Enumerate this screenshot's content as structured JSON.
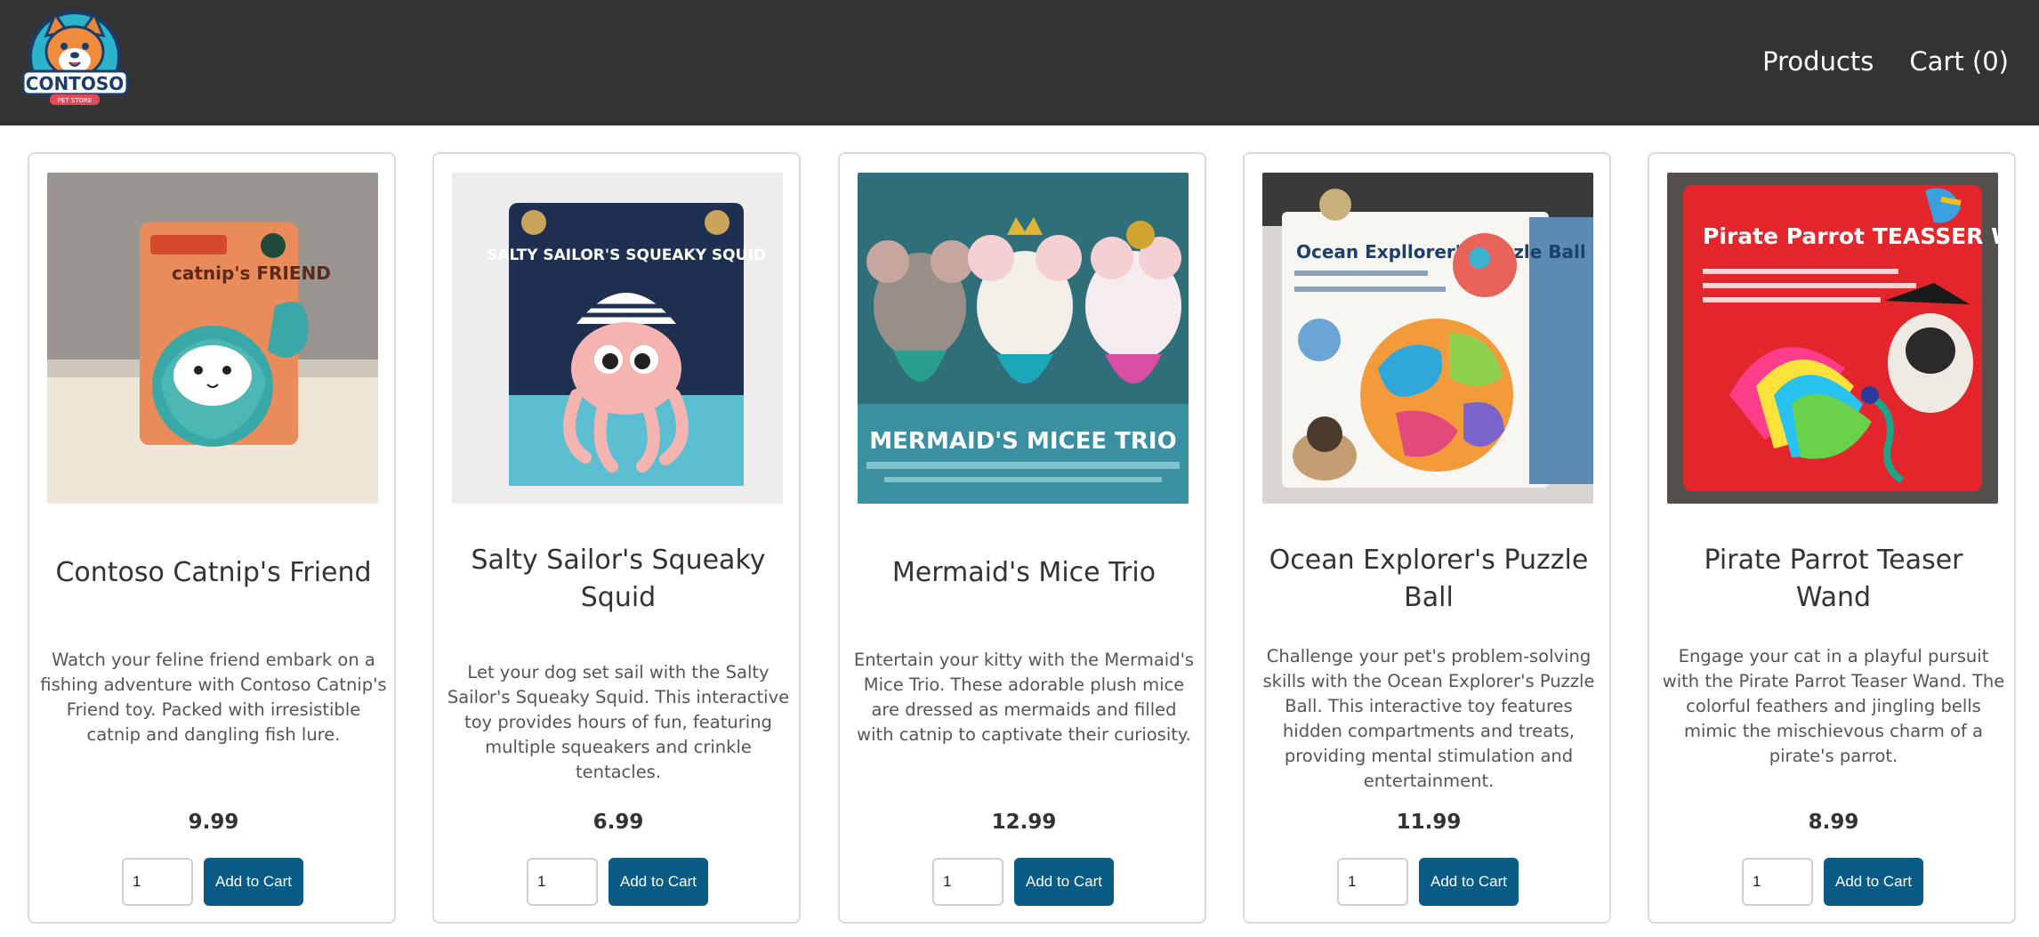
{
  "header": {
    "logo_alt": "Contoso Pet Store logo",
    "logo_text": "CONTOSO",
    "logo_subtext": "PET STORE",
    "nav": [
      {
        "label": "Products"
      },
      {
        "label": "Cart (0)"
      }
    ]
  },
  "colors": {
    "navbar_bg": "#333333",
    "button_bg": "#0a5b86",
    "card_border": "#dadada"
  },
  "products": [
    {
      "name": "Contoso Catnip's Friend",
      "description": "Watch your feline friend embark on a fishing adventure with Contoso Catnip's Friend toy. Packed with irresistible catnip and dangling fish lure.",
      "price": "9.99",
      "quantity": "1",
      "button_label": "Add to Cart",
      "image_text": "catnip's FRIEND"
    },
    {
      "name": "Salty Sailor's Squeaky Squid",
      "description": "Let your dog set sail with the Salty Sailor's Squeaky Squid. This interactive toy provides hours of fun, featuring multiple squeakers and crinkle tentacles.",
      "price": "6.99",
      "quantity": "1",
      "button_label": "Add to Cart",
      "image_text": "SALTY SAILOR'S SQUEAKY SQUID"
    },
    {
      "name": "Mermaid's Mice Trio",
      "description": "Entertain your kitty with the Mermaid's Mice Trio. These adorable plush mice are dressed as mermaids and filled with catnip to captivate their curiosity.",
      "price": "12.99",
      "quantity": "1",
      "button_label": "Add to Cart",
      "image_text": "MERMAID'S MICEE TRIO"
    },
    {
      "name": "Ocean Explorer's Puzzle Ball",
      "description": "Challenge your pet's problem-solving skills with the Ocean Explorer's Puzzle Ball. This interactive toy features hidden compartments and treats, providing mental stimulation and entertainment.",
      "price": "11.99",
      "quantity": "1",
      "button_label": "Add to Cart",
      "image_text": "Ocean Expllorer's Puzzle Ball"
    },
    {
      "name": "Pirate Parrot Teaser Wand",
      "description": "Engage your cat in a playful pursuit with the Pirate Parrot Teaser Wand. The colorful feathers and jingling bells mimic the mischievous charm of a pirate's parrot.",
      "price": "8.99",
      "quantity": "1",
      "button_label": "Add to Cart",
      "image_text": "Pirate Parrot TEASSER WAND"
    }
  ]
}
